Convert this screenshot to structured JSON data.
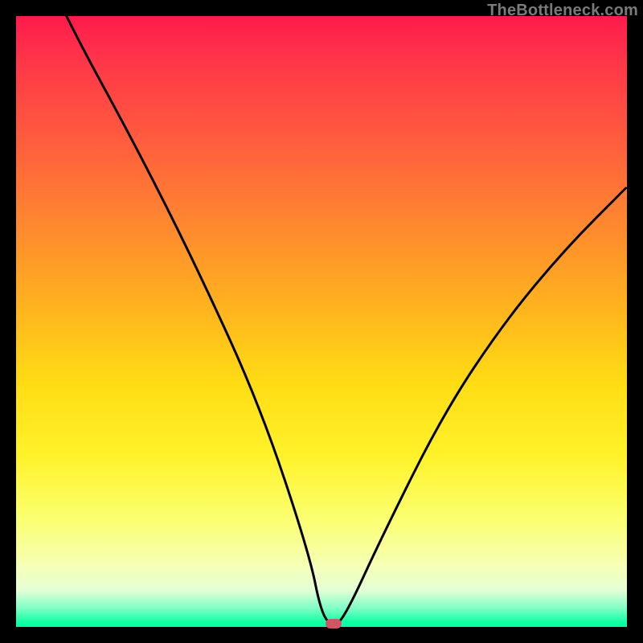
{
  "watermark": "TheBottleneck.com",
  "chart_data": {
    "type": "line",
    "title": "",
    "xlabel": "",
    "ylabel": "",
    "xlim": [
      0,
      100
    ],
    "ylim": [
      0,
      100
    ],
    "grid": false,
    "legend": false,
    "x": [
      0,
      8,
      20,
      30,
      40,
      48,
      50,
      52,
      54,
      60,
      70,
      80,
      90,
      100
    ],
    "values": [
      118,
      100,
      78,
      58,
      36,
      12,
      2,
      0,
      2,
      15,
      35,
      50,
      62,
      72
    ],
    "background": "vertical heatmap gradient red→orange→yellow→green",
    "marker_x": 52,
    "marker_y": 0
  },
  "colors": {
    "curve": "#000000",
    "marker": "#cf5665",
    "frame": "#000000"
  }
}
